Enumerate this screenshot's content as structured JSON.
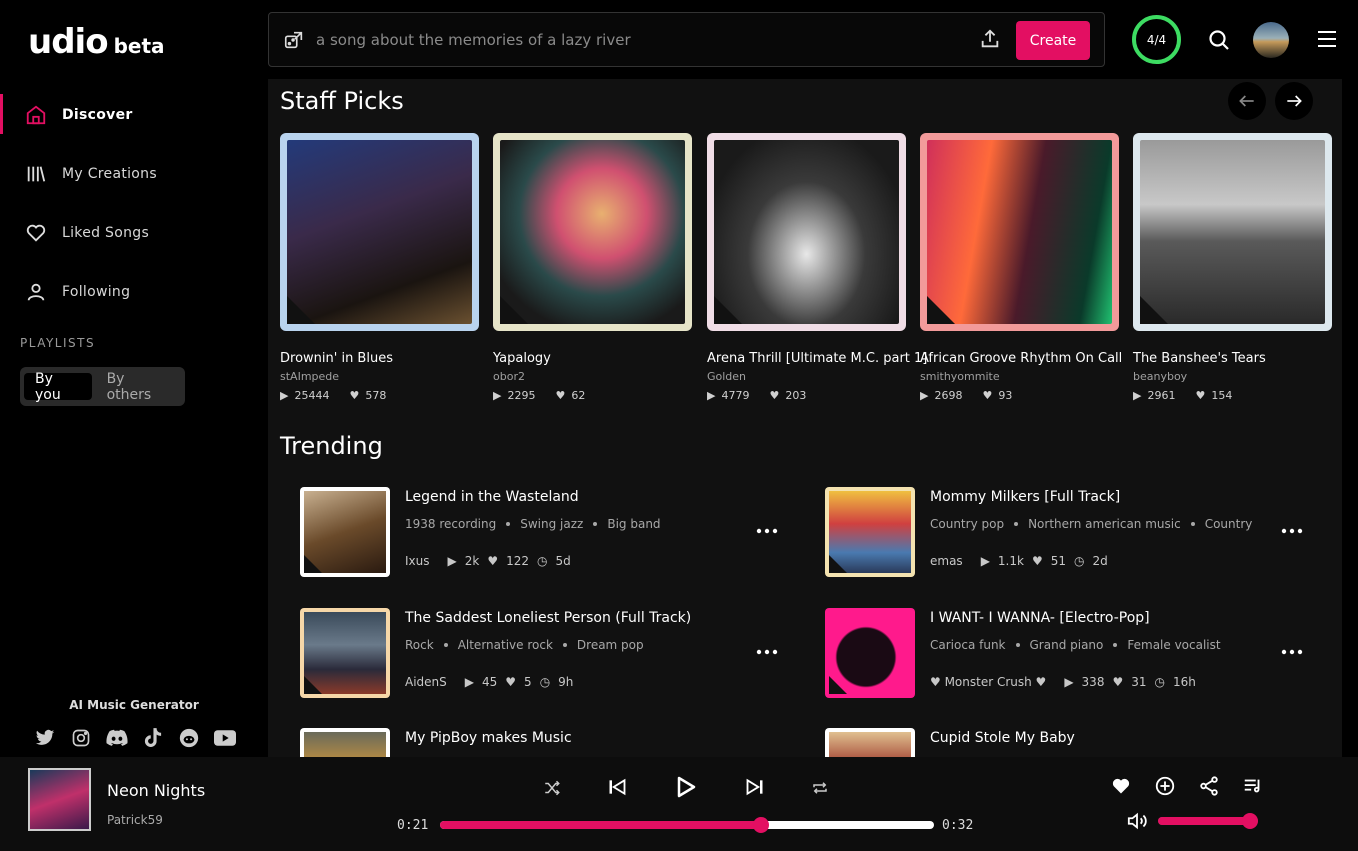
{
  "brand": {
    "name": "udio",
    "badge": "beta"
  },
  "nav": [
    {
      "label": "Discover",
      "icon": "home-icon",
      "active": true
    },
    {
      "label": "My Creations",
      "icon": "library-icon"
    },
    {
      "label": "Liked Songs",
      "icon": "heart-icon"
    },
    {
      "label": "Following",
      "icon": "person-icon"
    }
  ],
  "playlists": {
    "heading": "PLAYLISTS",
    "by_you": "By you",
    "by_others": "By others"
  },
  "footer": {
    "label": "AI Music Generator",
    "socials": [
      "twitter-icon",
      "instagram-icon",
      "discord-icon",
      "tiktok-icon",
      "reddit-icon",
      "youtube-icon"
    ]
  },
  "search": {
    "placeholder": "a song about the memories of a lazy river",
    "create_label": "Create"
  },
  "credits": "4/4",
  "staff_picks": {
    "title": "Staff Picks",
    "cards": [
      {
        "title": "Drownin' in Blues",
        "user": "stAImpede",
        "plays": "25444",
        "likes": "578",
        "frame": "#b9d3ee"
      },
      {
        "title": "Yapalogy",
        "user": "obor2",
        "plays": "2295",
        "likes": "62",
        "frame": "#e6e4c8"
      },
      {
        "title": "Arena Thrill [Ultimate M.C. part 1]",
        "user": "Golden",
        "plays": "4779",
        "likes": "203",
        "frame": "#f0dde6"
      },
      {
        "title": "African Groove Rhythm On Call",
        "user": "smithyommite",
        "plays": "2698",
        "likes": "93",
        "frame": "#f29a9a"
      },
      {
        "title": "The Banshee's Tears",
        "user": "beanyboy",
        "plays": "2961",
        "likes": "154",
        "frame": "#dde8ee"
      }
    ]
  },
  "trending": {
    "title": "Trending",
    "items": [
      {
        "title": "Legend in the Wasteland",
        "tags": [
          "1938 recording",
          "Swing jazz",
          "Big band"
        ],
        "user": "Ixus",
        "plays": "2k",
        "likes": "122",
        "age": "5d",
        "frame": "#ffffff"
      },
      {
        "title": "Mommy Milkers [Full Track]",
        "tags": [
          "Country pop",
          "Northern american music",
          "Country"
        ],
        "user": "emas",
        "plays": "1.1k",
        "likes": "51",
        "age": "2d",
        "frame": "#f4e3b0"
      },
      {
        "title": "The Saddest Loneliest Person (Full Track)",
        "tags": [
          "Rock",
          "Alternative rock",
          "Dream pop"
        ],
        "user": "AidenS",
        "plays": "45",
        "likes": "5",
        "age": "9h",
        "frame": "#f6d7a8"
      },
      {
        "title": "I WANT- I WANNA- [Electro-Pop]",
        "tags": [
          "Carioca funk",
          "Grand piano",
          "Female vocalist"
        ],
        "user": "♥ Monster Crush ♥",
        "plays": "338",
        "likes": "31",
        "age": "16h",
        "frame": "#ff1a8c"
      },
      {
        "title": "My PipBoy makes Music",
        "tags": [],
        "user": "",
        "plays": "",
        "likes": "",
        "age": "",
        "frame": "#ffffff"
      },
      {
        "title": "Cupid Stole My Baby",
        "tags": [],
        "user": "",
        "plays": "",
        "likes": "",
        "age": "",
        "frame": "#ffffff"
      }
    ]
  },
  "player": {
    "title": "Neon Nights",
    "artist": "Patrick59",
    "elapsed": "0:21",
    "duration": "0:32",
    "progress": 0.65,
    "volume": 0.96
  },
  "colors": {
    "accent": "#e30f62",
    "credits_ring": "#3ddc62"
  }
}
